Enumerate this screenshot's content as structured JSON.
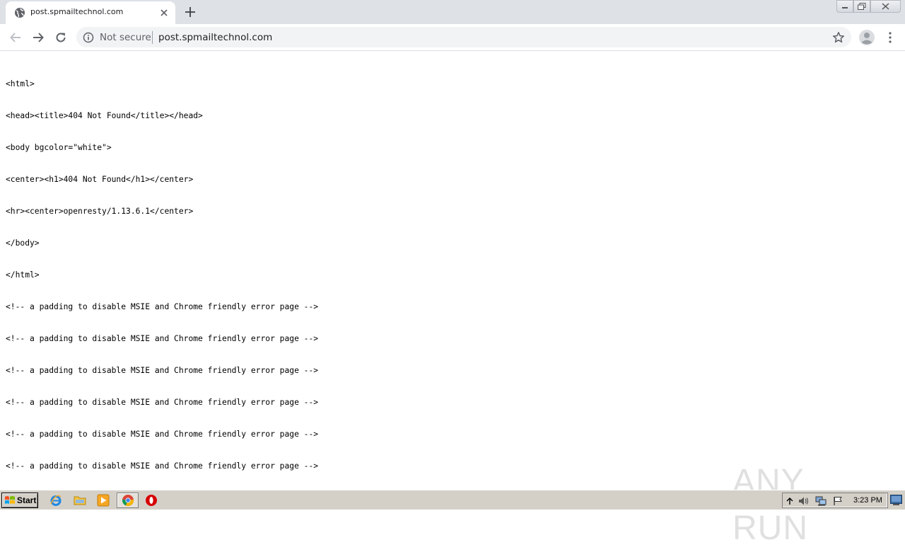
{
  "browser": {
    "tab": {
      "title": "post.spmailtechnol.com",
      "favicon": "globe-icon"
    },
    "omnibox": {
      "security_label": "Not secure",
      "url": "post.spmailtechnol.com"
    },
    "icons": {
      "back": "arrow-left-icon",
      "forward": "arrow-right-icon",
      "reload": "reload-icon",
      "info": "info-icon",
      "bookmark": "star-icon",
      "profile": "avatar-icon",
      "menu": "kebab-menu-icon",
      "new_tab": "plus-icon",
      "close_tab": "close-icon"
    },
    "colors": {
      "tabstrip": "#dee1e6",
      "omnibox": "#f1f3f4",
      "text": "#202124",
      "muted": "#5f6368"
    }
  },
  "page": {
    "source_lines": [
      "<html>",
      "<head><title>404 Not Found</title></head>",
      "<body bgcolor=\"white\">",
      "<center><h1>404 Not Found</h1></center>",
      "<hr><center>openresty/1.13.6.1</center>",
      "</body>",
      "</html>",
      "<!-- a padding to disable MSIE and Chrome friendly error page -->",
      "<!-- a padding to disable MSIE and Chrome friendly error page -->",
      "<!-- a padding to disable MSIE and Chrome friendly error page -->",
      "<!-- a padding to disable MSIE and Chrome friendly error page -->",
      "<!-- a padding to disable MSIE and Chrome friendly error page -->",
      "<!-- a padding to disable MSIE and Chrome friendly error page -->"
    ],
    "watermark": "ANY RUN"
  },
  "taskbar": {
    "start_label": "Start",
    "clock": "3:23 PM",
    "pinned": [
      "internet-explorer-icon",
      "folder-icon",
      "media-player-icon",
      "chrome-icon",
      "opera-icon"
    ],
    "tray": [
      "show-hidden-icons-arrow",
      "volume-icon",
      "network-icon",
      "action-center-flag-icon"
    ]
  }
}
